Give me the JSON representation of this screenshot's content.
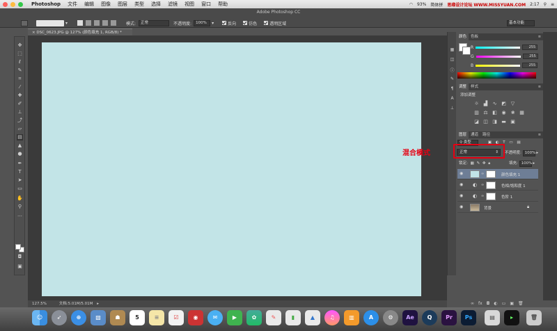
{
  "menubar": {
    "app_name": "Photoshop",
    "items": [
      "文件",
      "编辑",
      "图像",
      "图层",
      "类型",
      "选择",
      "滤镜",
      "视图",
      "窗口",
      "帮助"
    ],
    "battery": "93%",
    "clock": "2:17",
    "watermark": "思缘设计论坛 WWW.MISSYUAN.COM",
    "input_label": "简体拼"
  },
  "window": {
    "title": "Adobe Photoshop CC"
  },
  "options": {
    "mode_label": "模式:",
    "mode_value": "正常",
    "opacity_label": "不透明度:",
    "opacity_value": "100%",
    "reverse_label": "反向",
    "dither_label": "仿色",
    "transparency_label": "透明区域",
    "workspace": "基本功能"
  },
  "document": {
    "tab_title": "DSC_0623.JPG @ 127% (颜色填充 1, RGB/8) *",
    "zoom": "127.5%",
    "doc_info": "文档:5.01M/5.01M",
    "canvas_color": "#c2e4e7"
  },
  "color_panel": {
    "tabs": [
      "颜色",
      "色板"
    ],
    "channels": [
      {
        "label": "R",
        "value": "255"
      },
      {
        "label": "G",
        "value": "255"
      },
      {
        "label": "B",
        "value": "255"
      }
    ]
  },
  "adjust_panel": {
    "tabs": [
      "调整",
      "样式"
    ],
    "title": "添加调整"
  },
  "layers_panel": {
    "tabs": [
      "图层",
      "通道",
      "路径"
    ],
    "kind_label": "类型",
    "blend_mode": "正常",
    "opacity_label": "不透明度:",
    "opacity_value": "100%",
    "lock_label": "锁定:",
    "fill_label": "填充:",
    "fill_value": "100%",
    "layers": [
      {
        "name": "颜色填充 1",
        "selected": true
      },
      {
        "name": "色相/饱和度 1",
        "selected": false
      },
      {
        "name": "色阶 1",
        "selected": false
      },
      {
        "name": "背景",
        "selected": false
      }
    ]
  },
  "annotation": {
    "text": "混合模式",
    "color": "#e60012"
  },
  "dock": {
    "apps": [
      "Finder",
      "Launchpad",
      "Safari",
      "Preview",
      "Contacts",
      "Calendar",
      "Notes",
      "Reminders",
      "Photo Booth",
      "Messages",
      "FaceTime",
      "Photos",
      "iWork",
      "Numbers",
      "Keynote",
      "iTunes",
      "iBooks",
      "App Store",
      "System Preferences",
      "Ae",
      "QuickTime",
      "Pr",
      "Ps",
      "Preview2",
      "Terminal",
      "Trash"
    ],
    "calendar_day": "5"
  }
}
